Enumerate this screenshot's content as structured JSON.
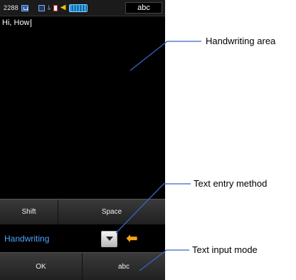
{
  "status_bar": {
    "time": "2288",
    "icons": [
      "message-icon",
      "square-icon",
      "usb-icon",
      "memory-card-icon",
      "speaker-icon",
      "battery-icon"
    ],
    "input_mode": "abc"
  },
  "text_field": {
    "value": "Hi, How"
  },
  "keyboard": {
    "shift_label": "Shift",
    "space_label": "Space",
    "method_value": "Handwriting",
    "ok_label": "OK",
    "mode_label": "abc"
  },
  "callouts": {
    "handwriting_area": "Handwriting area",
    "text_entry_method": "Text entry method",
    "text_input_mode": "Text input mode"
  },
  "colors": {
    "method_text": "#4fa3ff",
    "arrow": "#f3a21b",
    "callout_line": "#3a63c4"
  }
}
